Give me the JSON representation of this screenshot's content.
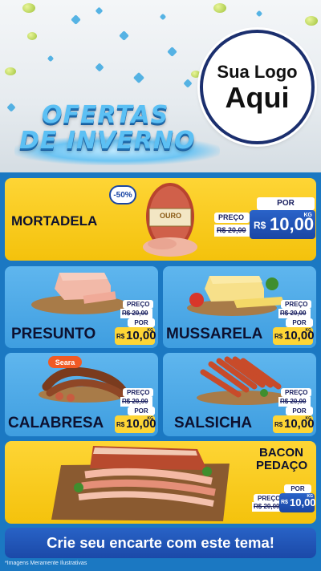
{
  "header": {
    "title_line1": "OFERTAS",
    "title_line2": "DE INVERNO",
    "logo_line1": "Sua Logo",
    "logo_line2": "Aqui"
  },
  "colors": {
    "page_bg": "#1b78c2",
    "card_yellow": "#f7c81a",
    "card_blue": "#4aa8e8",
    "price_blue": "#1a46a4",
    "text_dark": "#0d1130"
  },
  "products": {
    "mortadela": {
      "name": "MORTADELA",
      "badge": "-50%",
      "brand": "OURO",
      "preco_label": "PREÇO",
      "old_price": "R$ 20,00",
      "por_label": "POR",
      "currency": "R$",
      "price": "10,00",
      "unit": "KG"
    },
    "presunto": {
      "name": "PRESUNTO",
      "preco_label": "PREÇO",
      "old_price": "R$ 20,00",
      "por_label": "POR",
      "currency": "R$",
      "price": "10,00",
      "unit": "KG"
    },
    "mussarela": {
      "name": "MUSSARELA",
      "preco_label": "PREÇO",
      "old_price": "R$ 20,00",
      "por_label": "POR",
      "currency": "R$",
      "price": "10,00",
      "unit": "KG"
    },
    "calabresa": {
      "name": "CALABRESA",
      "brand": "Seara",
      "preco_label": "PREÇO",
      "old_price": "R$ 20,00",
      "por_label": "POR",
      "currency": "R$",
      "price": "10,00",
      "unit": "KG"
    },
    "salsicha": {
      "name": "SALSICHA",
      "preco_label": "PREÇO",
      "old_price": "R$ 20,00",
      "por_label": "POR",
      "currency": "R$",
      "price": "10,00",
      "unit": "KG"
    },
    "bacon": {
      "name_line1": "BACON",
      "name_line2": "PEDAÇO",
      "preco_label": "PREÇO",
      "old_price": "R$ 20,00",
      "por_label": "POR",
      "currency": "R$",
      "price": "10,00",
      "unit": "KG"
    }
  },
  "footer": {
    "cta": "Crie seu encarte com este tema!",
    "disclaimer": "*Imagens Meramente Ilustrativas"
  }
}
